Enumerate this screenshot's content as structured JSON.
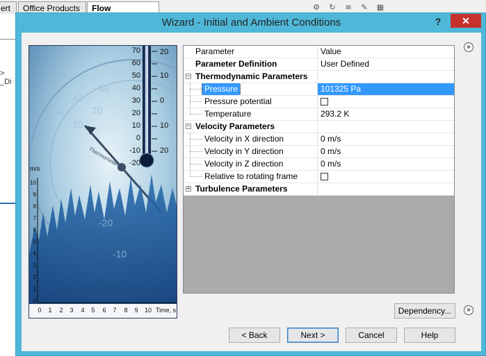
{
  "app": {
    "tabs": [
      {
        "label": "ert"
      },
      {
        "label": "Office Products"
      },
      {
        "label": "Flow Simulation"
      }
    ],
    "left_pane_text": "> _Di"
  },
  "dialog": {
    "title": "Wizard - Initial and Ambient Conditions",
    "help_label": "?",
    "close_label": "✕"
  },
  "illustration": {
    "thermometer_left_scale": [
      "70",
      "60",
      "50",
      "40",
      "30",
      "20",
      "10",
      "0",
      "-10",
      "-20"
    ],
    "thermometer_right_scale": [
      "20",
      "10",
      "0",
      "10",
      "20"
    ],
    "dial_labels": [
      "50",
      "40",
      "30",
      "20",
      "10",
      "-20",
      "-10"
    ],
    "dial_word": "Thermometer",
    "chart_ylabel": "m/s",
    "chart_yticks": [
      "10",
      "9",
      "8",
      "7",
      "6",
      "5",
      "4",
      "3",
      "2",
      "1",
      "0"
    ],
    "chart_xticks": [
      "0",
      "1",
      "2",
      "3",
      "4",
      "5",
      "6",
      "7",
      "8",
      "9",
      "10"
    ],
    "chart_xlabel": "Time, s"
  },
  "grid": {
    "header": {
      "parameter": "Parameter",
      "value": "Value"
    },
    "definition": {
      "label": "Parameter Definition",
      "value": "User Defined"
    },
    "thermo": {
      "label": "Thermodynamic Parameters",
      "expander": "−",
      "pressure": {
        "label": "Pressure",
        "value": "101325 Pa"
      },
      "pressure_potential": {
        "label": "Pressure potential",
        "checked": false
      },
      "temperature": {
        "label": "Temperature",
        "value": "293.2 K"
      }
    },
    "velocity": {
      "label": "Velocity Parameters",
      "expander": "−",
      "vx": {
        "label": "Velocity in X direction",
        "value": "0 m/s"
      },
      "vy": {
        "label": "Velocity in Y direction",
        "value": "0 m/s"
      },
      "vz": {
        "label": "Velocity in Z direction",
        "value": "0 m/s"
      },
      "rotating": {
        "label": "Relative to rotating frame",
        "checked": false
      }
    },
    "turbulence": {
      "label": "Turbulence Parameters",
      "expander": "+"
    }
  },
  "buttons": {
    "collapse_top": "»",
    "collapse_bottom": "»",
    "dependency": "Dependency...",
    "back": "< Back",
    "next": "Next >",
    "cancel": "Cancel",
    "help": "Help"
  },
  "colors": {
    "dialog_frame": "#4fb8d9",
    "selection": "#3399ff",
    "close": "#c7322d"
  }
}
